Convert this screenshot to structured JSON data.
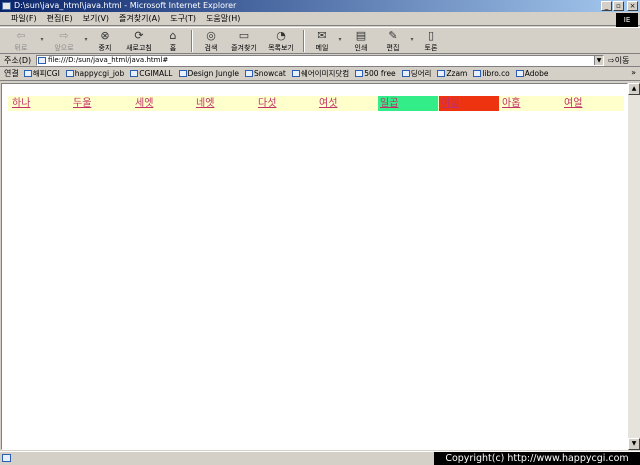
{
  "window": {
    "title": "D:\\sun\\java_html\\java.html - Microsoft Internet Explorer",
    "buttons": {
      "minimize": "_",
      "maximize": "▫",
      "close": "×"
    },
    "brand": "IE"
  },
  "menubar": {
    "items": [
      "파일(F)",
      "편집(E)",
      "보기(V)",
      "즐겨찾기(A)",
      "도구(T)",
      "도움말(H)"
    ]
  },
  "toolbar": {
    "back": "뒤로",
    "forward": "앞으로",
    "stop": "중지",
    "refresh": "새로고침",
    "home": "홈",
    "search": "검색",
    "favorites": "즐겨찾기",
    "history": "목록보기",
    "mail": "메일",
    "print": "인쇄",
    "edit": "편집",
    "discuss": "토론"
  },
  "address": {
    "label": "주소(D)",
    "value": "file:///D:/sun/java_html/java.html#",
    "go": "⇨이동"
  },
  "links": {
    "label": "연결",
    "items": [
      "해피CGI",
      "happycgi_job",
      "CGIMALL",
      "Design Jungle",
      "Snowcat",
      "쉐어이미지닷컴",
      "500 free",
      "딩어리",
      "Zzam",
      "libro.co",
      "Adobe"
    ],
    "more": "»"
  },
  "nav": {
    "items": [
      "하나",
      "두울",
      "세엣",
      "네엣",
      "다섯",
      "여섯",
      "일곱",
      "여덟",
      "아홉",
      "여얼"
    ],
    "highlight_colors": {
      "6": "#33ee88",
      "7": "#ee3311"
    },
    "bar_color": "#ffffcc",
    "link_color": "#c0306a"
  },
  "status": {
    "copyright": "Copyright(c) http://www.happycgi.com"
  }
}
